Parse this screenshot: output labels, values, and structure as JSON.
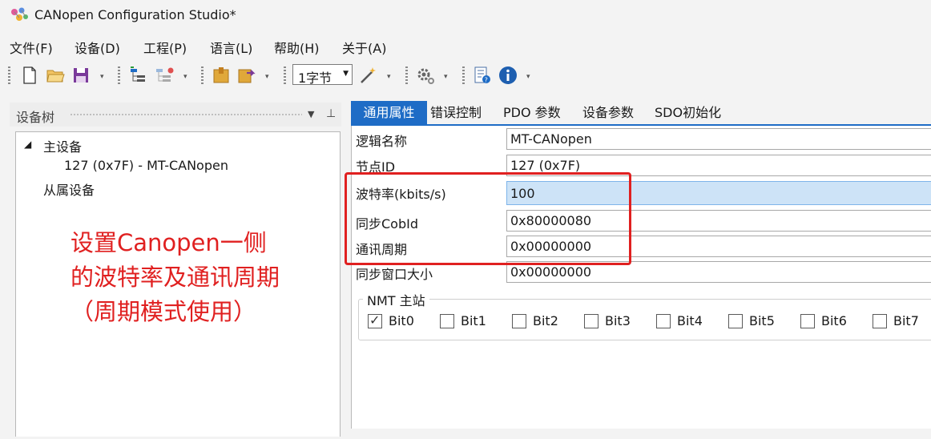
{
  "window": {
    "title": "CANopen Configuration Studio*"
  },
  "menu": [
    "文件(F)",
    "设备(D)",
    "工程(P)",
    "语言(L)",
    "帮助(H)",
    "关于(A)"
  ],
  "toolbar": {
    "size_select_value": "1字节"
  },
  "device_tree": {
    "title": "设备树",
    "master_label": "主设备",
    "master_node": "127 (0x7F)  -  MT-CANopen",
    "slave_label": "从属设备"
  },
  "annotation": {
    "line1": "设置Canopen一侧",
    "line2": "的波特率及通讯周期",
    "line3": "（周期模式使用）"
  },
  "tabs": [
    "通用属性",
    "错误控制",
    "PDO 参数",
    "设备参数",
    "SDO初始化"
  ],
  "active_tab": "通用属性",
  "properties": [
    {
      "label": "逻辑名称",
      "value": "MT-CANopen"
    },
    {
      "label": "节点ID",
      "value": "127 (0x7F)"
    },
    {
      "label": "波特率(kbits/s)",
      "value": "100"
    },
    {
      "label": "同步CobId",
      "value": "0x80000080"
    },
    {
      "label": "通讯周期",
      "value": "0x00000000"
    },
    {
      "label": "同步窗口大小",
      "value": "0x00000000"
    }
  ],
  "nmt": {
    "title": "NMT 主站",
    "bits": [
      {
        "label": "Bit0",
        "checked": true
      },
      {
        "label": "Bit1",
        "checked": false
      },
      {
        "label": "Bit2",
        "checked": false
      },
      {
        "label": "Bit3",
        "checked": false
      },
      {
        "label": "Bit4",
        "checked": false
      },
      {
        "label": "Bit5",
        "checked": false
      },
      {
        "label": "Bit6",
        "checked": false
      },
      {
        "label": "Bit7",
        "checked": false
      }
    ]
  },
  "colors": {
    "accent": "#1e6cc6",
    "annotation": "#e02020",
    "selected_field": "#cde3f7"
  }
}
